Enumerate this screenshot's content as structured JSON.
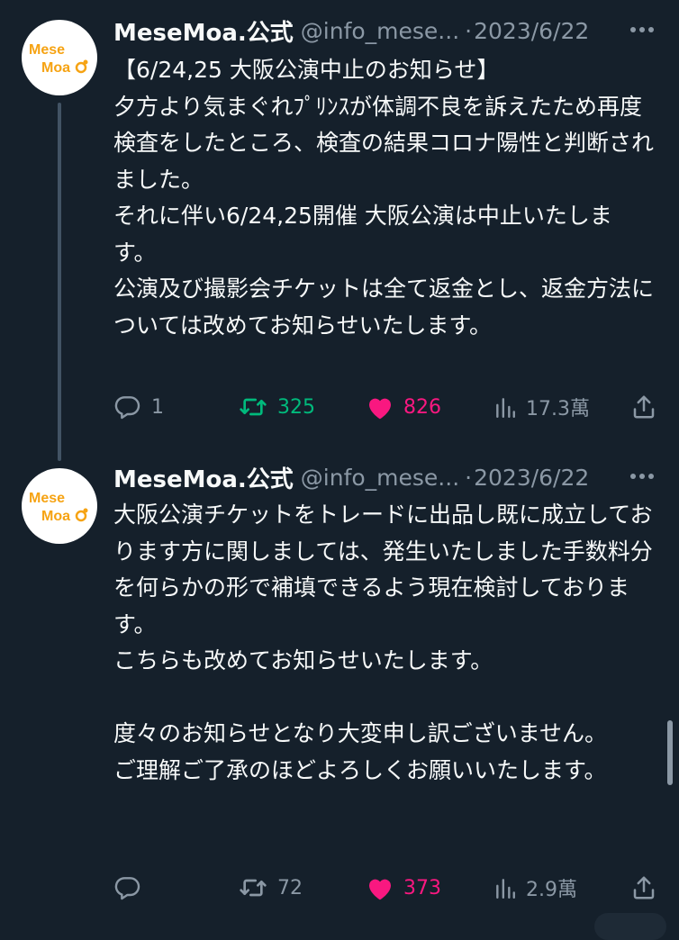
{
  "colors": {
    "background": "#15202b",
    "text_primary": "#f7f9f9",
    "text_secondary": "#8b98a5",
    "retweet_active": "#00ba7c",
    "like_active": "#f91880",
    "avatar_text": "#f6a313"
  },
  "tweets": [
    {
      "avatar": {
        "logo_text_line1": "Mese",
        "logo_text_line2": "Moa"
      },
      "name": "MeseMoa.公式",
      "handle": "@info_mese...",
      "separator": "·",
      "date": "2023/6/22",
      "body": "【6/24,25 大阪公演中止のお知らせ】\n夕方より気まぐれﾌﾟﾘﾝｽが体調不良を訴えたため再度検査をしたところ、検査の結果コロナ陽性と判断されました。\nそれに伴い6/24,25開催 大阪公演は中止いたします。\n公演及び撮影会チケットは全て返金とし、返金方法については改めてお知らせいたします。",
      "replies": "1",
      "retweets": "325",
      "likes": "826",
      "views": "17.3萬",
      "icons": {
        "reply": "reply-icon",
        "retweet": "retweet-icon",
        "like": "heart-icon",
        "views": "views-icon",
        "share": "share-icon",
        "more": "more-icon"
      }
    },
    {
      "avatar": {
        "logo_text_line1": "Mese",
        "logo_text_line2": "Moa"
      },
      "name": "MeseMoa.公式",
      "handle": "@info_mese...",
      "separator": "·",
      "date": "2023/6/22",
      "body": "大阪公演チケットをトレードに出品し既に成立しております方に関しましては、発生いたしました手数料分を何らかの形で補填できるよう現在検討しております。\nこちらも改めてお知らせいたします。\n\n度々のお知らせとなり大変申し訳ございません。\nご理解ご了承のほどよろしくお願いいたします。",
      "replies": "",
      "retweets": "72",
      "likes": "373",
      "views": "2.9萬",
      "icons": {
        "reply": "reply-icon",
        "retweet": "retweet-icon",
        "like": "heart-icon",
        "views": "views-icon",
        "share": "share-icon",
        "more": "more-icon"
      }
    }
  ]
}
